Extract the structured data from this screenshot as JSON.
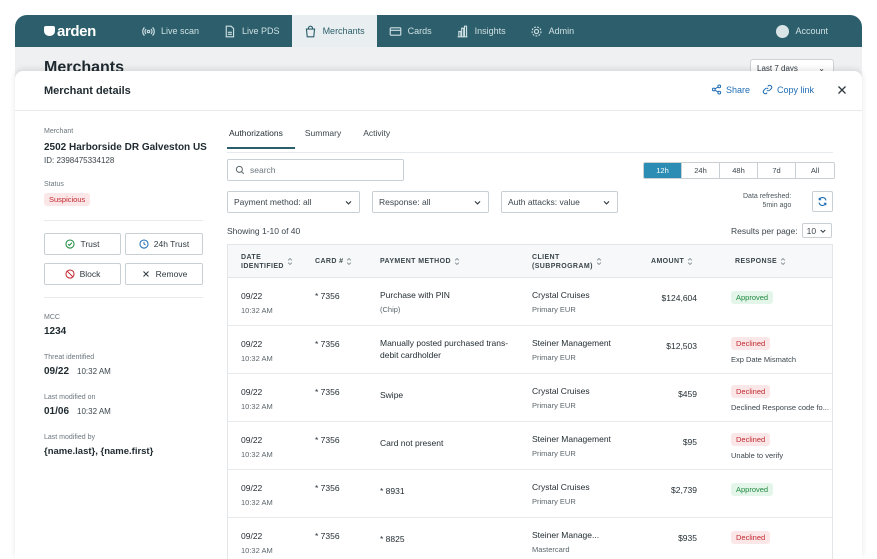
{
  "app": {
    "logo_text": "arden",
    "nav": [
      {
        "label": "Live scan",
        "icon": "radio-waves-icon",
        "active": false
      },
      {
        "label": "Live PDS",
        "icon": "document-icon",
        "active": false
      },
      {
        "label": "Merchants",
        "icon": "shopping-bag-icon",
        "active": true
      },
      {
        "label": "Cards",
        "icon": "credit-card-icon",
        "active": false
      },
      {
        "label": "Insights",
        "icon": "bar-chart-icon",
        "active": false
      },
      {
        "label": "Admin",
        "icon": "gear-icon",
        "active": false
      }
    ],
    "account_label": "Account",
    "background_title": "Merchants",
    "background_range": "Last 7 days"
  },
  "modal": {
    "title": "Merchant details",
    "share_label": "Share",
    "copy_link_label": "Copy link"
  },
  "merchant": {
    "merchant_label": "Merchant",
    "name": "2502 Harborside DR Galveston US",
    "id_text": "ID: 2398475334128",
    "status_label": "Status",
    "status": "Suspicious",
    "actions": {
      "trust": "Trust",
      "trust_24h": "24h Trust",
      "block": "Block",
      "remove": "Remove"
    },
    "mcc_label": "MCC",
    "mcc": "1234",
    "threat_label": "Threat identified",
    "threat_date": "09/22",
    "threat_time": "10:32 AM",
    "modified_label": "Last modified on",
    "modified_date": "01/06",
    "modified_time": "10:32 AM",
    "modified_by_label": "Last modified by",
    "modified_by": "{name.last}, {name.first}"
  },
  "tabs": [
    "Authorizations",
    "Summary",
    "Activity"
  ],
  "filters": {
    "search_placeholder": "search",
    "ranges": [
      "12h",
      "24h",
      "48h",
      "7d",
      "All"
    ],
    "active_range": "12h",
    "payment_method": "Payment method: all",
    "response": "Response: all",
    "auth_attacks": "Auth attacks: value",
    "refreshed_line1": "Data refreshed:",
    "refreshed_line2": "5min ago"
  },
  "table": {
    "showing": "Showing 1-10 of 40",
    "rpp_label": "Results per page:",
    "rpp_value": "10",
    "columns": {
      "date": "DATE\nIDENTIFIED",
      "card": "CARD #",
      "payment": "PAYMENT METHOD",
      "client": "CLIENT\n(SUBPROGRAM)",
      "amount": "AMOUNT",
      "response": "RESPONSE"
    },
    "rows": [
      {
        "date": "09/22",
        "time": "10:32 AM",
        "card": "* 7356",
        "payment": "Purchase with PIN",
        "payment_sub": "(Chip)",
        "client": "Crystal Cruises",
        "subprogram": "Primary EUR",
        "amount": "$124,604",
        "response": "Approved",
        "response_type": "green",
        "response_note": ""
      },
      {
        "date": "09/22",
        "time": "10:32 AM",
        "card": "* 7356",
        "payment": "Manually posted purchased trans-",
        "payment_sub": "debit cardholder",
        "client": "Steiner Management",
        "subprogram": "Primary EUR",
        "amount": "$12,503",
        "response": "Declined",
        "response_type": "red",
        "response_note": "Exp Date Mismatch"
      },
      {
        "date": "09/22",
        "time": "10:32 AM",
        "card": "* 7356",
        "payment": "Swipe",
        "payment_sub": "",
        "client": "Crystal Cruises",
        "subprogram": "Primary EUR",
        "amount": "$459",
        "response": "Declined",
        "response_type": "red",
        "response_note": "Declined Response code fo..."
      },
      {
        "date": "09/22",
        "time": "10:32 AM",
        "card": "* 7356",
        "payment": "Card not present",
        "payment_sub": "",
        "client": "Steiner Management",
        "subprogram": "Primary EUR",
        "amount": "$95",
        "response": "Declined",
        "response_type": "red",
        "response_note": "Unable to verify"
      },
      {
        "date": "09/22",
        "time": "10:32 AM",
        "card": "* 7356",
        "payment": "* 8931",
        "payment_sub": "",
        "client": "Crystal Cruises",
        "subprogram": "Primary EUR",
        "amount": "$2,739",
        "response": "Approved",
        "response_type": "green",
        "response_note": ""
      },
      {
        "date": "09/22",
        "time": "10:32 AM",
        "card": "* 7356",
        "payment": "* 8825",
        "payment_sub": "",
        "client": "Steiner Manage...",
        "subprogram": "Mastercard",
        "amount": "$935",
        "response": "Declined",
        "response_type": "red",
        "response_note": ""
      }
    ]
  }
}
